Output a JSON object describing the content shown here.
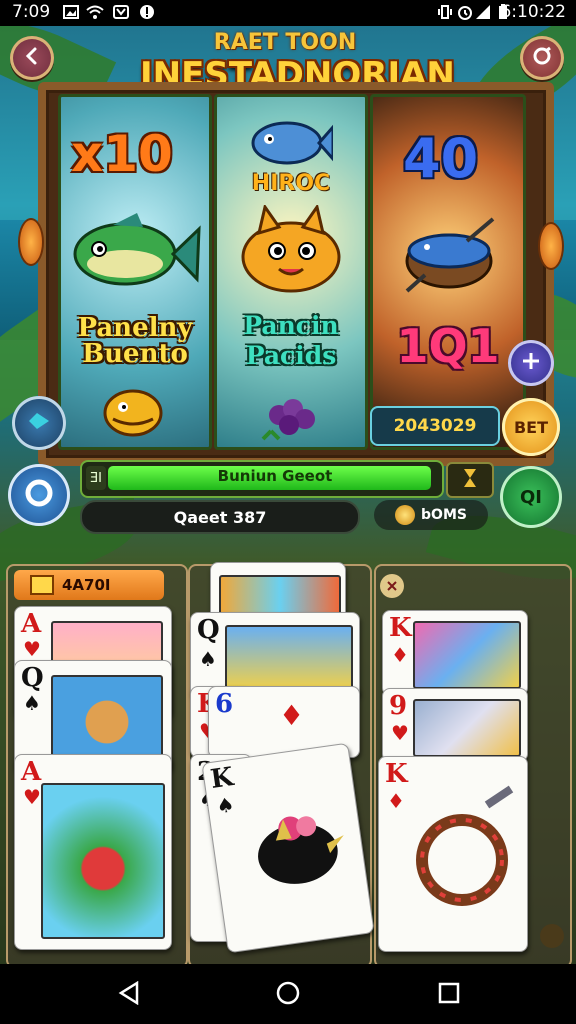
{
  "status_bar": {
    "time": "7:09",
    "clock": "6:10:22",
    "icons": [
      "image-icon",
      "wifi-icon",
      "missed-call-icon",
      "alert-icon",
      "vibrate-icon",
      "alarm-icon",
      "signal-icon",
      "battery-icon"
    ]
  },
  "header": {
    "back_icon": "chevron-left-icon",
    "settings_icon": "gear-icon",
    "title_small": "RAET TOON",
    "title_big": "INESTADNORIAN"
  },
  "reels": [
    {
      "multiplier": "x10",
      "text": "Panelny Buento",
      "symbols": [
        "fish-icon",
        "fish-icon"
      ]
    },
    {
      "multiplier": "HIROC",
      "text": "Pancin Pacids",
      "symbols": [
        "fish-icon",
        "fox-icon",
        "berry-icon"
      ]
    },
    {
      "multiplier": "40",
      "text": "1Q1",
      "symbols": [
        "whale-icon"
      ]
    }
  ],
  "controls": {
    "reel_display": "2043029",
    "bet_label": "BET",
    "spin_icon": "spin-icon",
    "fish_icon": "fish-icon",
    "plus_icon": "plus-icon",
    "progress": {
      "icon_text": "ƎI",
      "label": "Buniun Geeot",
      "fill_fraction": 0.98
    },
    "hourglass_icon": "hourglass-icon",
    "gem_button": "QI",
    "quest_text": "Qaeet 387",
    "coins_text": "bOMS"
  },
  "card_panels": [
    {
      "tab_label": "4A70I",
      "cards": [
        {
          "rank": "A",
          "suit": "♥",
          "color": "#d11a1a"
        },
        {
          "rank": "Q",
          "suit": "♠",
          "color": "#111111"
        },
        {
          "rank": "A",
          "suit": "♥",
          "color": "#d11a1a"
        }
      ]
    },
    {
      "tab_label": "",
      "cards": [
        {
          "rank": "Q",
          "suit": "♠",
          "color": "#111111"
        },
        {
          "rank": "K",
          "suit": "♥",
          "color": "#d11a1a"
        },
        {
          "rank": "6",
          "suit": "♦",
          "color": "#1a3acc"
        },
        {
          "rank": "2",
          "suit": "♠",
          "color": "#111111"
        },
        {
          "rank": "K",
          "suit": "♠",
          "color": "#111111"
        }
      ]
    },
    {
      "tab_label": "",
      "cards": [
        {
          "rank": "K",
          "suit": "♦",
          "color": "#d11a1a"
        },
        {
          "rank": "9",
          "suit": "♥",
          "color": "#d11a1a"
        },
        {
          "rank": "K",
          "suit": "♦",
          "color": "#d11a1a"
        }
      ]
    }
  ],
  "nav": {
    "back_icon": "back-triangle-icon",
    "home_icon": "home-circle-icon",
    "recents_icon": "recents-square-icon"
  }
}
